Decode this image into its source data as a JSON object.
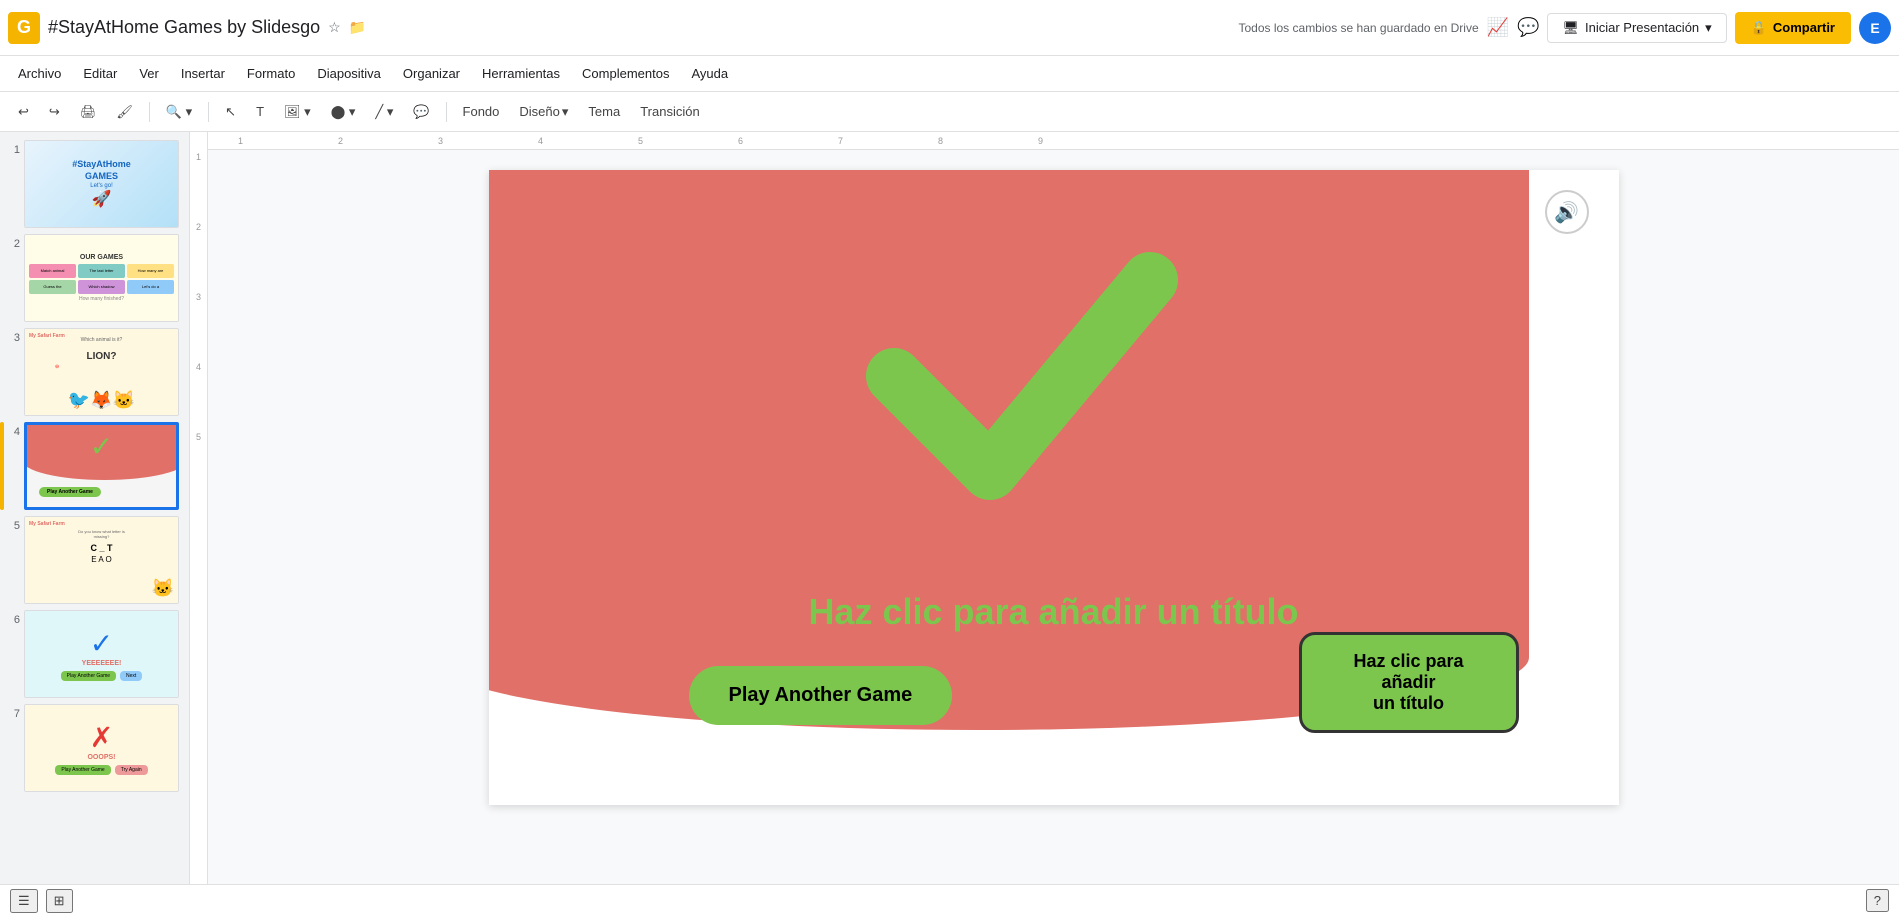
{
  "app": {
    "icon": "G",
    "title": "#StayAtHome Games by Slidesgo",
    "autosave": "Todos los cambios se han guardado en Drive"
  },
  "header": {
    "present_label": "Iniciar Presentación",
    "share_label": "Compartir",
    "avatar_letter": "E"
  },
  "menu": {
    "items": [
      "Archivo",
      "Editar",
      "Ver",
      "Insertar",
      "Formato",
      "Diapositiva",
      "Organizar",
      "Herramientas",
      "Complementos",
      "Ayuda"
    ]
  },
  "toolbar": {
    "fondo": "Fondo",
    "diseno": "Diseño",
    "tema": "Tema",
    "transicion": "Transición"
  },
  "slides": [
    {
      "num": 1,
      "type": "cover"
    },
    {
      "num": 2,
      "type": "games"
    },
    {
      "num": 3,
      "type": "animal"
    },
    {
      "num": 4,
      "type": "check",
      "active": true
    },
    {
      "num": 5,
      "type": "letter"
    },
    {
      "num": 6,
      "type": "correct"
    },
    {
      "num": 7,
      "type": "wrong"
    }
  ],
  "slide4": {
    "checkmark": "✓",
    "title_placeholder": "Haz clic para añadir un título",
    "btn_play": "Play Another Game",
    "btn_second_line1": "Haz clic para añadir",
    "btn_second_line2": "un título",
    "audio_icon": "🔊"
  },
  "ruler": {
    "marks": [
      "1",
      "2",
      "3",
      "4",
      "5",
      "6",
      "7",
      "8",
      "9"
    ],
    "vmarks": [
      "1",
      "2",
      "3",
      "4",
      "5"
    ]
  }
}
